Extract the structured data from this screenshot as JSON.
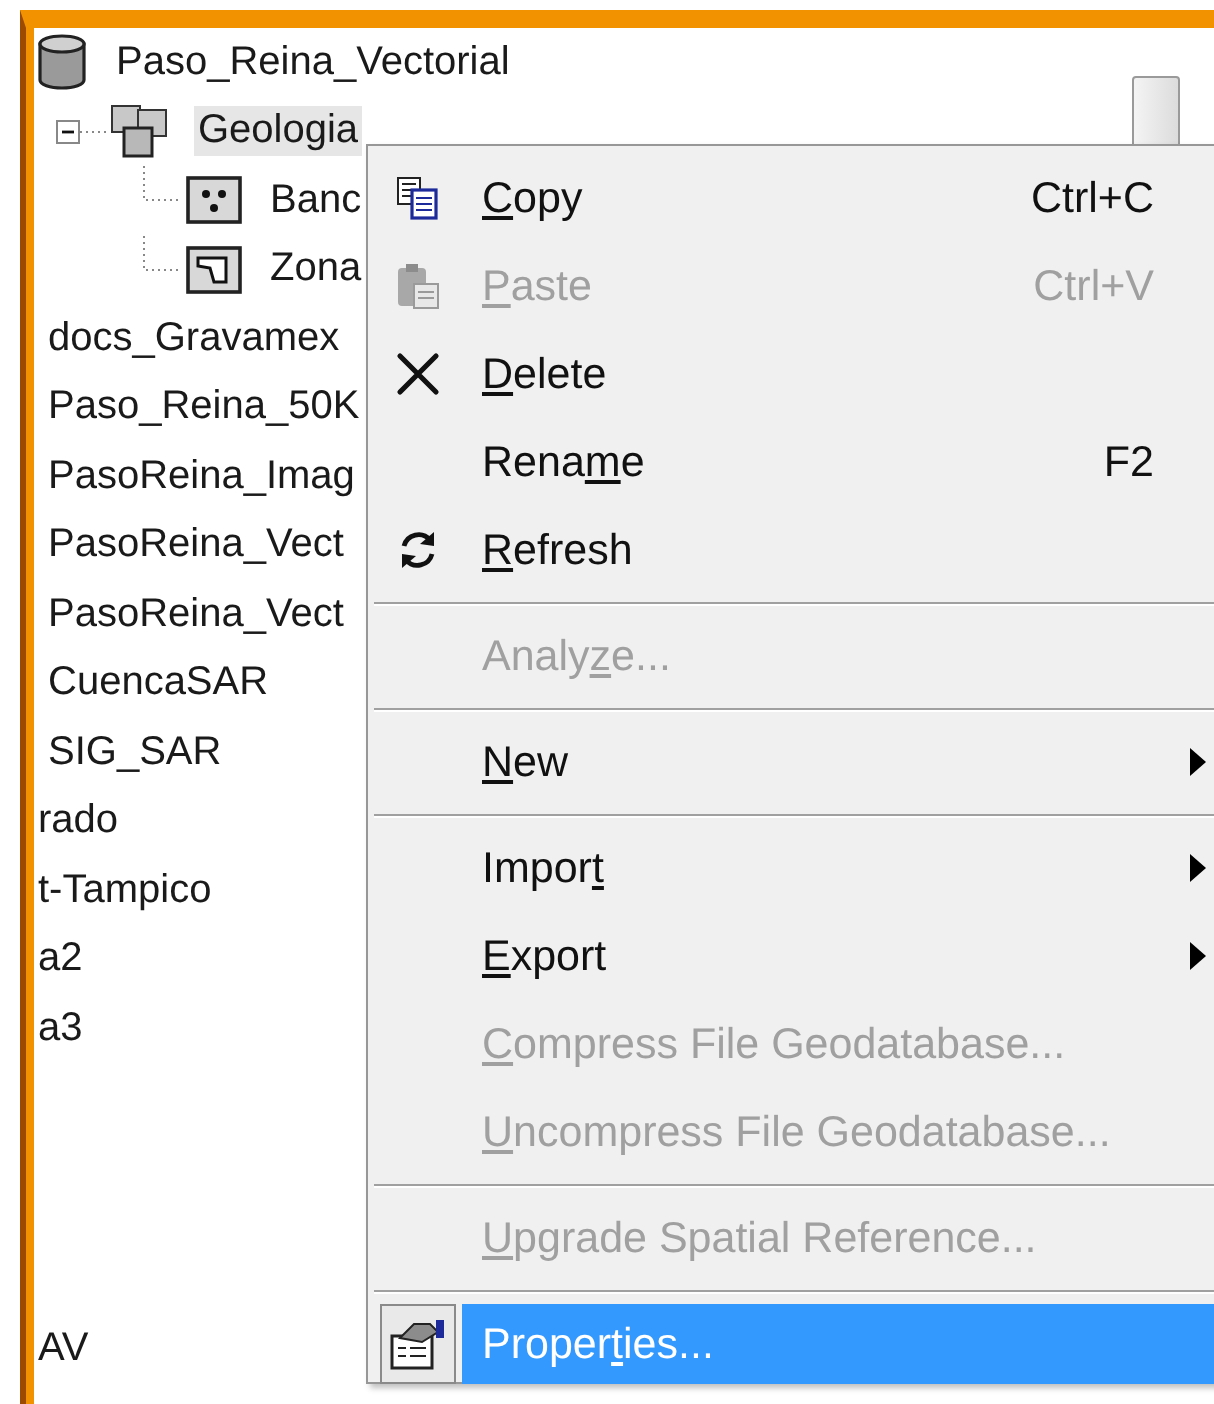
{
  "tree": [
    {
      "label": "Paso_Reina_Vectorial",
      "kind": "geodatabase",
      "selected": false,
      "children": [
        {
          "label": "Geologia",
          "kind": "dataset",
          "selected": true,
          "expanded": true,
          "children": [
            {
              "label": "Banc",
              "kind": "point-class",
              "selected": false
            },
            {
              "label": "Zona",
              "kind": "polygon-class",
              "selected": false
            }
          ]
        }
      ]
    },
    {
      "label": "docs_Gravamex",
      "kind": "item",
      "selected": false
    },
    {
      "label": "Paso_Reina_50K",
      "kind": "item",
      "selected": false
    },
    {
      "label": "PasoReina_Imag",
      "kind": "item",
      "selected": false
    },
    {
      "label": "PasoReina_Vect",
      "kind": "item",
      "selected": false
    },
    {
      "label": "PasoReina_Vect",
      "kind": "item",
      "selected": false
    },
    {
      "label": "CuencaSAR",
      "kind": "item",
      "selected": false
    },
    {
      "label": "SIG_SAR",
      "kind": "item",
      "selected": false
    },
    {
      "label": "rado",
      "kind": "clipped",
      "selected": false
    },
    {
      "label": "t-Tampico",
      "kind": "clipped",
      "selected": false
    },
    {
      "label": "a2",
      "kind": "clipped",
      "selected": false
    },
    {
      "label": "a3",
      "kind": "clipped",
      "selected": false
    },
    {
      "label": "AV",
      "kind": "clipped",
      "selected": false
    }
  ],
  "context_menu": [
    {
      "kind": "copy",
      "key": "C",
      "after": "opy",
      "shortcut": "Ctrl+C",
      "disabled": false,
      "selected": false
    },
    {
      "kind": "paste",
      "key": "P",
      "after": "aste",
      "shortcut": "Ctrl+V",
      "disabled": true,
      "selected": false
    },
    {
      "kind": "delete",
      "key": "D",
      "after": "elete",
      "disabled": false,
      "selected": false
    },
    {
      "kind": "plain",
      "before": "Rena",
      "key": "m",
      "after": "e",
      "shortcut": "F2",
      "disabled": false,
      "selected": false
    },
    {
      "kind": "refresh",
      "key": "R",
      "after": "efresh",
      "disabled": false,
      "selected": false
    },
    {
      "kind": "separator"
    },
    {
      "kind": "plain",
      "before": "Analy",
      "key": "z",
      "after": "e...",
      "disabled": true,
      "selected": false
    },
    {
      "kind": "separator"
    },
    {
      "kind": "plain",
      "key": "N",
      "after": "ew",
      "submenu": true,
      "disabled": false,
      "selected": false
    },
    {
      "kind": "separator"
    },
    {
      "kind": "plain",
      "before": "Impor",
      "key": "t",
      "submenu": true,
      "disabled": false,
      "selected": false
    },
    {
      "kind": "plain",
      "key": "E",
      "after": "xport",
      "submenu": true,
      "disabled": false,
      "selected": false
    },
    {
      "kind": "plain",
      "key": "C",
      "after": "ompress File Geodatabase...",
      "disabled": true,
      "selected": false
    },
    {
      "kind": "plain",
      "key": "U",
      "after": "ncompress File Geodatabase...",
      "disabled": true,
      "selected": false
    },
    {
      "kind": "separator"
    },
    {
      "kind": "plain",
      "key": "U",
      "after": "pgrade Spatial Reference...",
      "disabled": true,
      "selected": false
    },
    {
      "kind": "separator"
    },
    {
      "kind": "properties",
      "before": "Proper",
      "key": "t",
      "after": "ies...",
      "disabled": false,
      "selected": true
    }
  ]
}
